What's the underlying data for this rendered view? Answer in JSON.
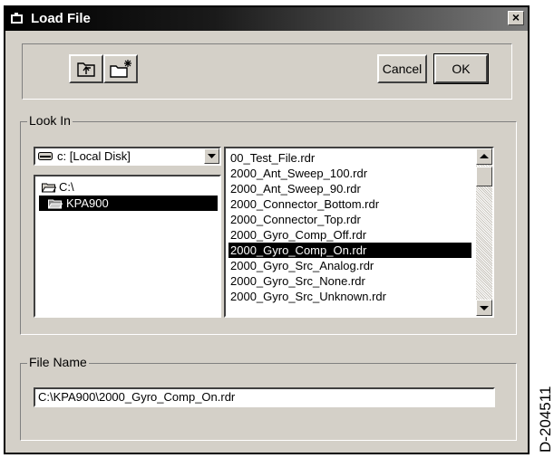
{
  "window": {
    "title": "Load File",
    "close_glyph": "×"
  },
  "toolbar": {
    "up_folder_icon": "folder-up-icon",
    "new_folder_icon": "new-folder-icon",
    "cancel_label": "Cancel",
    "ok_label": "OK"
  },
  "look_in": {
    "label": "Look In",
    "drive_value": "c: [Local Disk]",
    "directories": [
      {
        "label": "C:\\",
        "selected": false
      },
      {
        "label": "KPA900",
        "selected": true
      }
    ],
    "files": [
      "00_Test_File.rdr",
      "2000_Ant_Sweep_100.rdr",
      "2000_Ant_Sweep_90.rdr",
      "2000_Connector_Bottom.rdr",
      "2000_Connector_Top.rdr",
      "2000_Gyro_Comp_Off.rdr",
      "2000_Gyro_Comp_On.rdr",
      "2000_Gyro_Src_Analog.rdr",
      "2000_Gyro_Src_None.rdr",
      "2000_Gyro_Src_Unknown.rdr"
    ],
    "selected_file": "2000_Gyro_Comp_On.rdr"
  },
  "file_name": {
    "label": "File Name",
    "value": "C:\\KPA900\\2000_Gyro_Comp_On.rdr"
  },
  "doc_id": "D-204511"
}
